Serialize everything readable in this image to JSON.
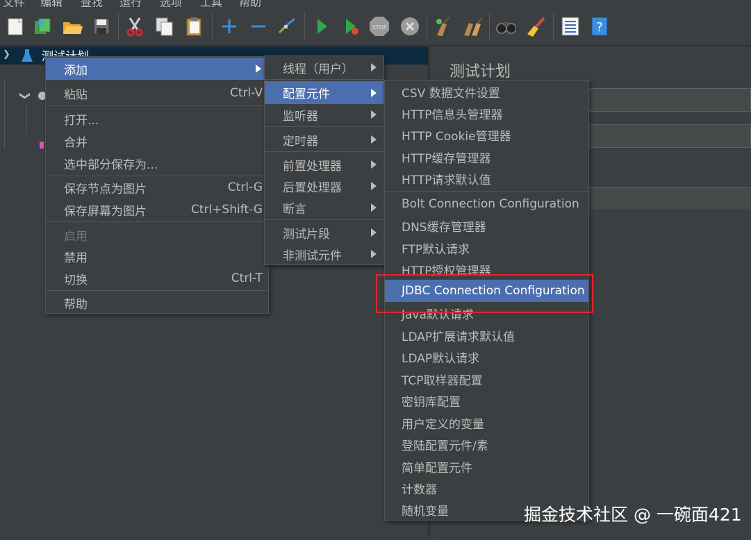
{
  "menubar": {
    "items": [
      "文件",
      "编辑",
      "查找",
      "运行",
      "选项",
      "工具",
      "帮助"
    ]
  },
  "toolbar": {
    "icons": [
      "new-icon",
      "templates-icon",
      "open-icon",
      "save-icon",
      "cut-icon",
      "copy-icon",
      "paste-icon",
      "expand-icon",
      "collapse-icon",
      "toggle-icon",
      "start-icon",
      "start-no-pause-icon",
      "stop-icon",
      "shutdown-icon",
      "clear-icon",
      "clear-all-icon",
      "search-icon",
      "reset-search-icon",
      "function-helper-icon",
      "help-icon"
    ]
  },
  "tree": {
    "root_label": "测试计划"
  },
  "right_panel": {
    "title": "测试计划"
  },
  "context_menu": {
    "add": "添加",
    "paste": "粘贴",
    "paste_shortcut": "Ctrl-V",
    "open": "打开...",
    "merge": "合并",
    "save_selection": "选中部分保存为...",
    "save_node_image": "保存节点为图片",
    "save_node_image_shortcut": "Ctrl-G",
    "save_screen_image": "保存屏幕为图片",
    "save_screen_image_shortcut": "Ctrl+Shift-G",
    "enable": "启用",
    "disable": "禁用",
    "toggle": "切换",
    "toggle_shortcut": "Ctrl-T",
    "help": "帮助"
  },
  "add_submenu": {
    "threads": "线程（用户）",
    "config_element": "配置元件",
    "listener": "监听器",
    "timer": "定时器",
    "pre_processor": "前置处理器",
    "post_processor": "后置处理器",
    "assertion": "断言",
    "test_fragment": "测试片段",
    "non_test_element": "非测试元件"
  },
  "config_submenu": {
    "items": [
      "CSV 数据文件设置",
      "HTTP信息头管理器",
      "HTTP Cookie管理器",
      "HTTP缓存管理器",
      "HTTP请求默认值",
      "Bolt Connection Configuration",
      "DNS缓存管理器",
      "FTP默认请求",
      "HTTP授权管理器",
      "JDBC Connection Configuration",
      "Java默认请求",
      "LDAP扩展请求默认值",
      "LDAP默认请求",
      "TCP取样器配置",
      "密钥库配置",
      "用户定义的变量",
      "登陆配置元件/素",
      "简单配置元件",
      "计数器",
      "随机变量"
    ],
    "selected": "JDBC Connection Configuration"
  },
  "colors": {
    "selection": "#4b6eaf",
    "highlight_box": "#e0262e",
    "background": "#3c3f41"
  },
  "watermark": "掘金技术社区 @ 一碗面421"
}
